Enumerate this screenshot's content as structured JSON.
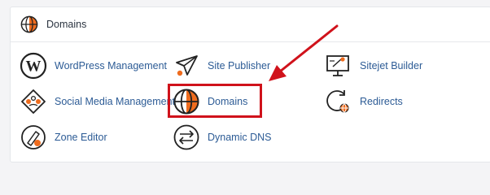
{
  "panel": {
    "title": "Domains",
    "title_icon": "globe-icon"
  },
  "items": {
    "wordpress": {
      "label": "WordPress Management",
      "icon": "wordpress-icon"
    },
    "site_publisher": {
      "label": "Site Publisher",
      "icon": "paper-plane-icon"
    },
    "sitejet": {
      "label": "Sitejet Builder",
      "icon": "monitor-paint-icon"
    },
    "social_media": {
      "label": "Social Media Management",
      "icon": "social-media-icon"
    },
    "domains": {
      "label": "Domains",
      "icon": "globe-icon"
    },
    "redirects": {
      "label": "Redirects",
      "icon": "redirect-globe-icon"
    },
    "zone_editor": {
      "label": "Zone Editor",
      "icon": "zone-editor-icon"
    },
    "dynamic_dns": {
      "label": "Dynamic DNS",
      "icon": "dynamic-dns-icon"
    }
  },
  "colors": {
    "link": "#2c5b95",
    "accent_orange": "#ef6c1e",
    "highlight_red": "#d0121b"
  }
}
